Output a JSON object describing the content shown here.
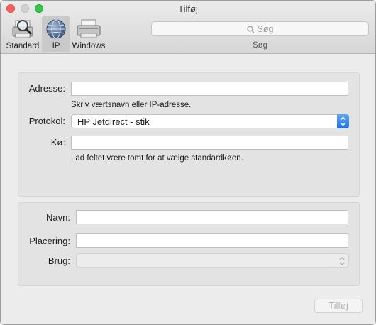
{
  "window": {
    "title": "Tilføj"
  },
  "toolbar": {
    "items": [
      {
        "label": "Standard",
        "icon": "printer-magnifier-icon",
        "selected": false
      },
      {
        "label": "IP",
        "icon": "globe-network-icon",
        "selected": true
      },
      {
        "label": "Windows",
        "icon": "windows-printer-icon",
        "selected": false
      }
    ],
    "search": {
      "placeholder": "Søg",
      "label": "Søg"
    }
  },
  "form": {
    "address": {
      "label": "Adresse:",
      "value": "",
      "hint": "Skriv værtsnavn eller IP-adresse."
    },
    "protocol": {
      "label": "Protokol:",
      "selected": "HP Jetdirect - stik"
    },
    "queue": {
      "label": "Kø:",
      "value": "",
      "hint": "Lad feltet være tomt for at vælge standardkøen."
    },
    "name": {
      "label": "Navn:",
      "value": ""
    },
    "location": {
      "label": "Placering:",
      "value": ""
    },
    "use": {
      "label": "Brug:",
      "selected": ""
    }
  },
  "actions": {
    "add_label": "Tilføj"
  },
  "colors": {
    "accent": "#2f7ef0",
    "close": "#fc605c",
    "maximize": "#34c84a"
  }
}
